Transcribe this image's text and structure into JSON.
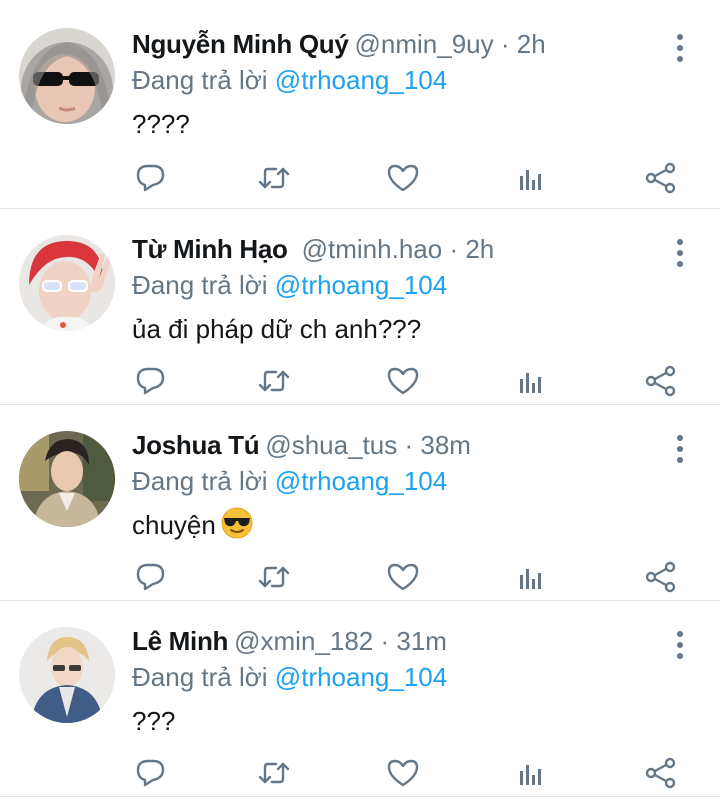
{
  "colors": {
    "link": "#1da1f2",
    "secondary_text": "#657786",
    "primary_text": "#14171a"
  },
  "tweets": [
    {
      "name": "Nguyễn Minh Quý",
      "handle": "@nmin_9uy",
      "time": "· 2h",
      "reply_prefix": "Đang trả lời",
      "reply_mention": "@trhoang_104",
      "text": "????",
      "avatar": "avatar-photo-gray-hood-sunglasses"
    },
    {
      "name": "Từ Minh Hạo",
      "handle": "@tminh.hao",
      "time": "· 2h",
      "reply_prefix": "Đang trả lời",
      "reply_mention": "@trhoang_104",
      "text": "ủa đi pháp dữ ch anh???",
      "avatar": "avatar-photo-red-hair-peace-sign"
    },
    {
      "name": "Joshua Tú",
      "handle": "@shua_tus",
      "time": "· 38m",
      "reply_prefix": "Đang trả lời",
      "reply_mention": "@trhoang_104",
      "text": "chuyện",
      "emoji": "smiling-face-with-sunglasses-emoji",
      "avatar": "avatar-photo-beige-coat-outdoors"
    },
    {
      "name": "Lê Minh",
      "handle": "@xmin_182",
      "time": "· 31m",
      "reply_prefix": "Đang trả lời",
      "reply_mention": "@trhoang_104",
      "text": "???",
      "avatar": "avatar-photo-blonde-denim-jacket"
    }
  ],
  "action_icons": [
    "reply-icon",
    "retweet-icon",
    "like-icon",
    "analytics-icon",
    "share-icon"
  ]
}
